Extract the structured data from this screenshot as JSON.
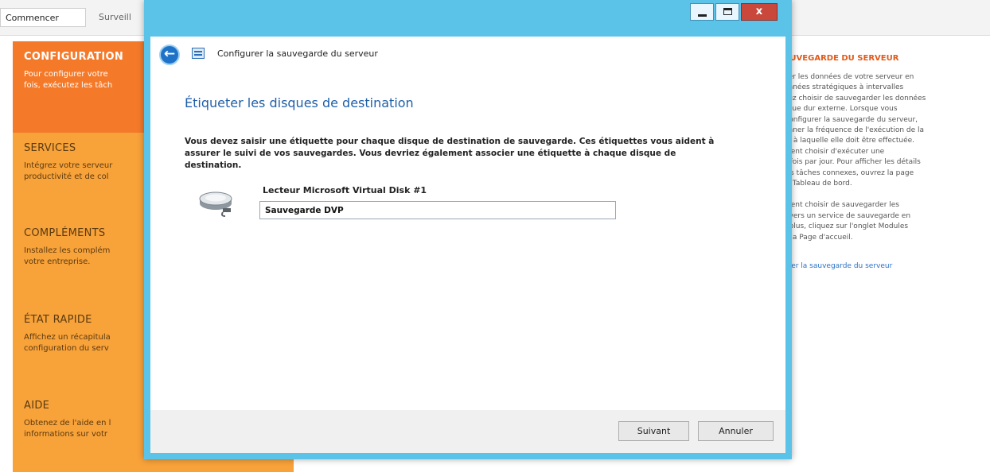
{
  "topbar": {
    "tabs": [
      "Commencer",
      "Surveill"
    ]
  },
  "tiles": [
    {
      "title": "CONFIGURATION",
      "text": [
        "Pour configurer votre",
        "fois, exécutez les tâch"
      ]
    },
    {
      "title": "SERVICES",
      "text": [
        "Intégrez votre serveur",
        "productivité et de col"
      ]
    },
    {
      "title": "COMPLÉMENTS",
      "text": [
        "Installez les complém",
        "votre entreprise."
      ]
    },
    {
      "title": "ÉTAT RAPIDE",
      "text": [
        "Affichez un récapitula",
        "configuration du serv"
      ]
    },
    {
      "title": "AIDE",
      "text": [
        "Obtenez de l'aide en l",
        "informations sur votr"
      ]
    }
  ],
  "right_panel": {
    "title": "AUVEGARDE DU SERVEUR",
    "para1": [
      "ger les données de votre serveur en",
      "onnées stratégiques à intervalles",
      "vez choisir de sauvegarder les données",
      "sque dur externe. Lorsque vous",
      "Configurer la sauvegarde du serveur,",
      "onner la fréquence de l'exécution de la",
      "re à laquelle elle doit être effectuée.",
      "ment choisir d'exécuter une",
      "s fois par jour.  Pour afficher les détails",
      "les tâches connexes, ouvrez la page",
      "le Tableau de bord."
    ],
    "para2": [
      "ment choisir de sauvegarder les",
      "r vers un service de sauvegarde en",
      "r plus, cliquez sur l'onglet Modules",
      "e la Page d'accueil."
    ],
    "link": "urer la sauvegarde du serveur"
  },
  "window": {
    "controls": {
      "close_glyph": "x"
    },
    "back_glyph": "←",
    "title": "Configurer la sauvegarde du serveur",
    "heading": "Étiqueter les disques de destination",
    "description": "Vous devez saisir une étiquette pour chaque disque de destination de sauvegarde. Ces étiquettes vous aident à assurer le suivi de vos sauvegardes. Vous devriez également associer une étiquette à chaque disque de destination.",
    "disk": {
      "label": "Lecteur Microsoft Virtual Disk #1",
      "value": "Sauvegarde DVP"
    },
    "buttons": {
      "next": "Suivant",
      "cancel": "Annuler"
    }
  },
  "colors": {
    "accent_orange": "#f47a2a",
    "tile_orange": "#f8a23a",
    "window_frame": "#5bc3e8",
    "heading_blue": "#1f5fa8"
  }
}
